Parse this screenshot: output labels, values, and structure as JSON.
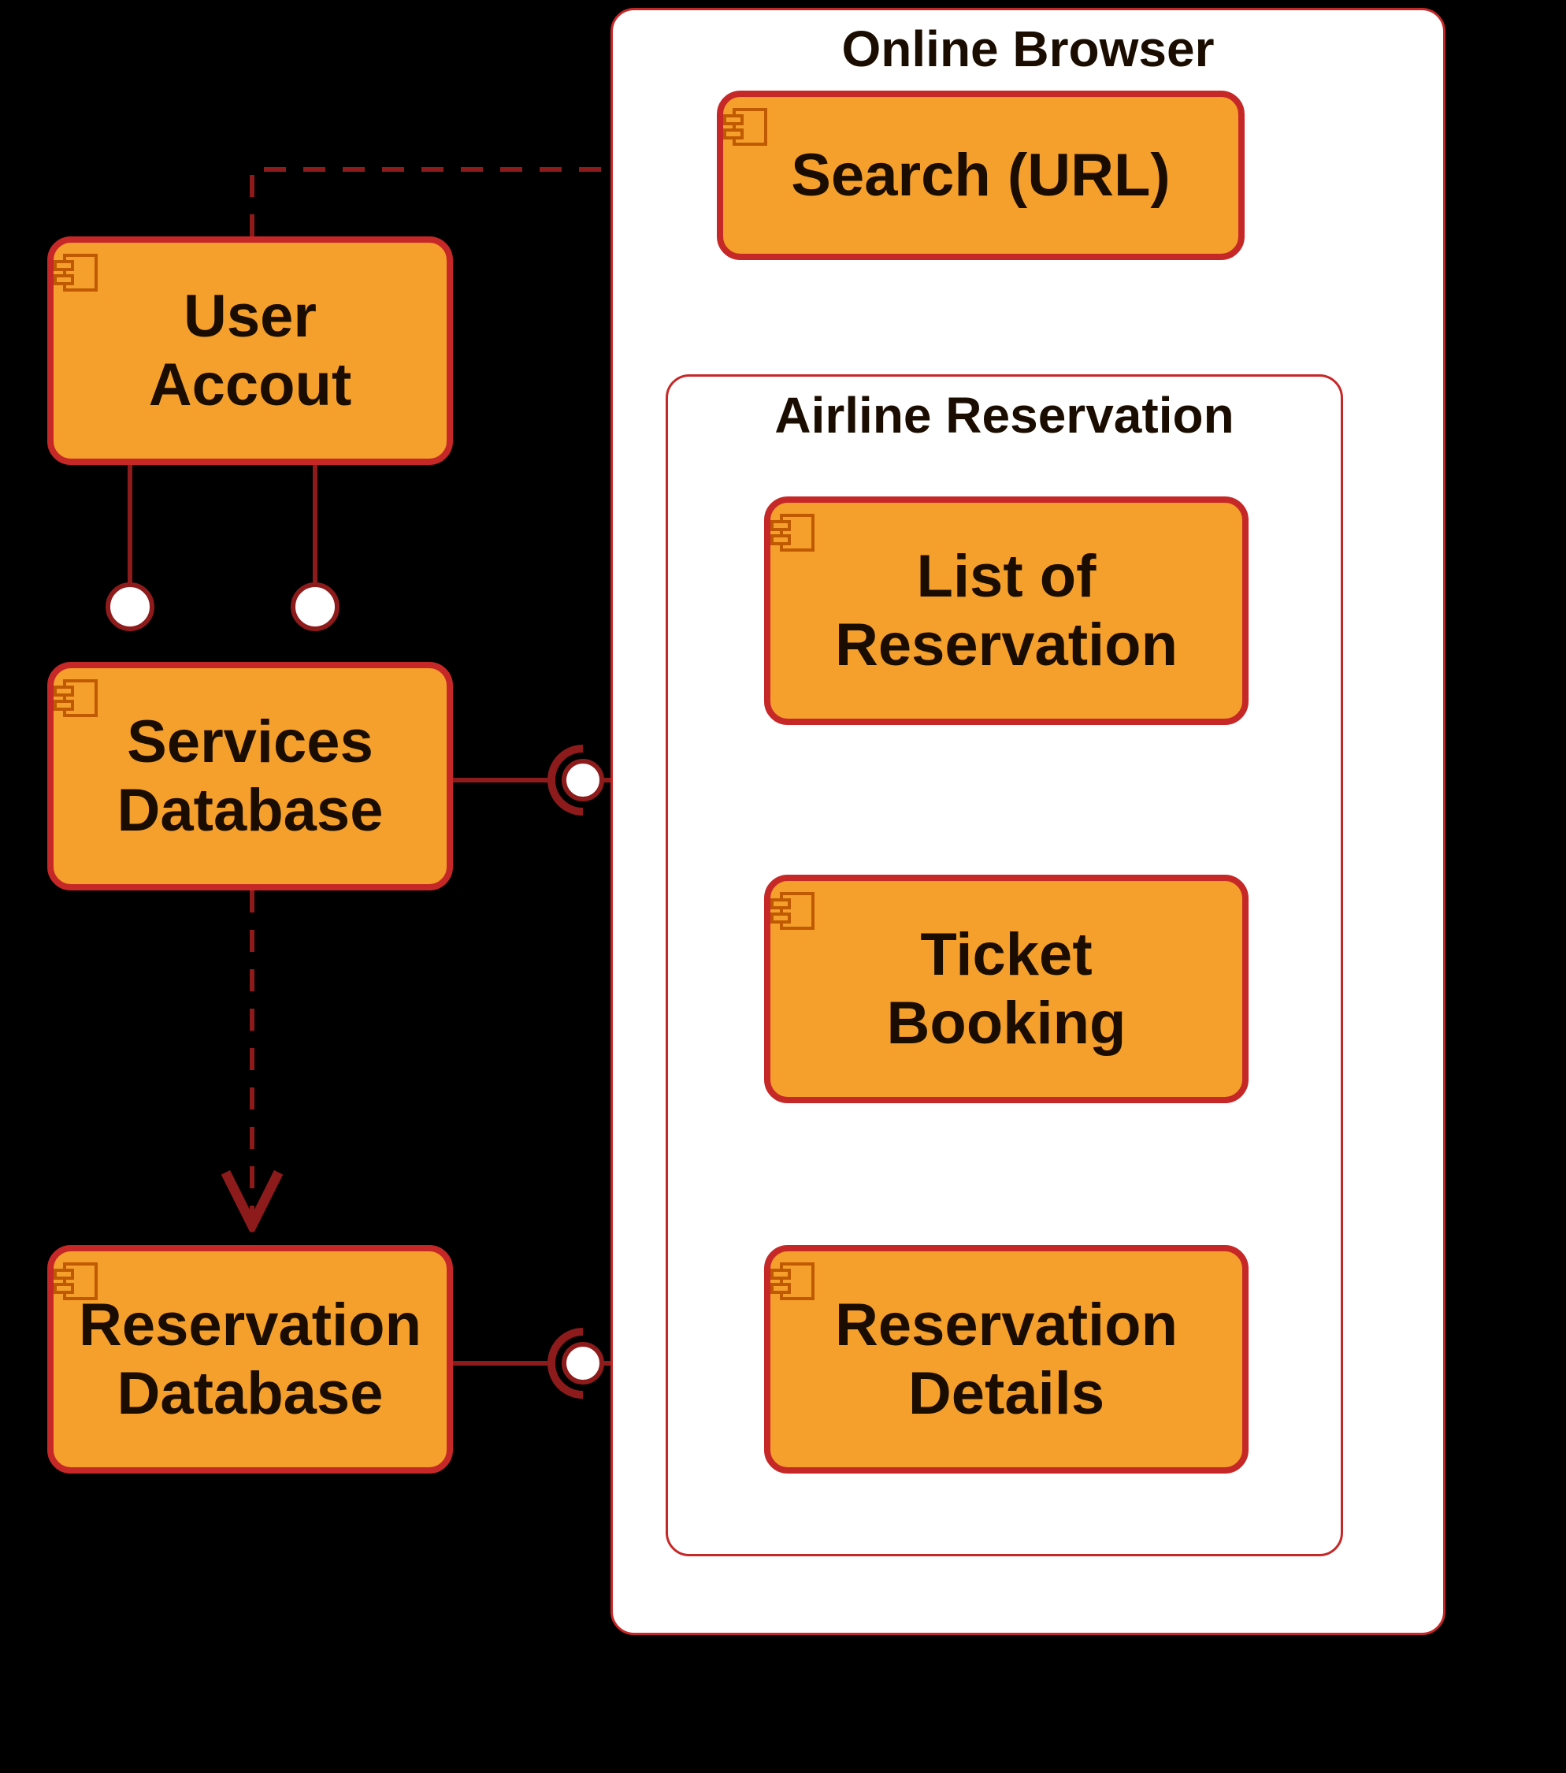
{
  "containers": {
    "online_browser": {
      "title": "Online Browser"
    },
    "airline_reservation": {
      "title": "Airline Reservation"
    }
  },
  "components": {
    "user_account": {
      "label": "User Accout"
    },
    "services_database": {
      "label": "Services Database"
    },
    "reservation_database": {
      "label": "Reservation Database"
    },
    "search_url": {
      "label": "Search (URL)"
    },
    "list_of_reservation": {
      "label": "List of Reservation"
    },
    "ticket_booking": {
      "label": "Ticket Booking"
    },
    "reservation_details": {
      "label": "Reservation Details"
    }
  },
  "connectors": [
    {
      "from": "user_account",
      "to": "search_url",
      "style": "dashed-arrow"
    },
    {
      "from": "user_account",
      "to": "services_database",
      "style": "double-lollipop"
    },
    {
      "from": "services_database",
      "to": "reservation_database",
      "style": "dashed-arrow"
    },
    {
      "from": "services_database",
      "to": "list_of_reservation+ticket_booking",
      "style": "socket-split"
    },
    {
      "from": "reservation_database",
      "to": "reservation_details",
      "style": "socket"
    },
    {
      "from": "search_url",
      "to": "ticket_booking",
      "style": "square-joint"
    }
  ]
}
